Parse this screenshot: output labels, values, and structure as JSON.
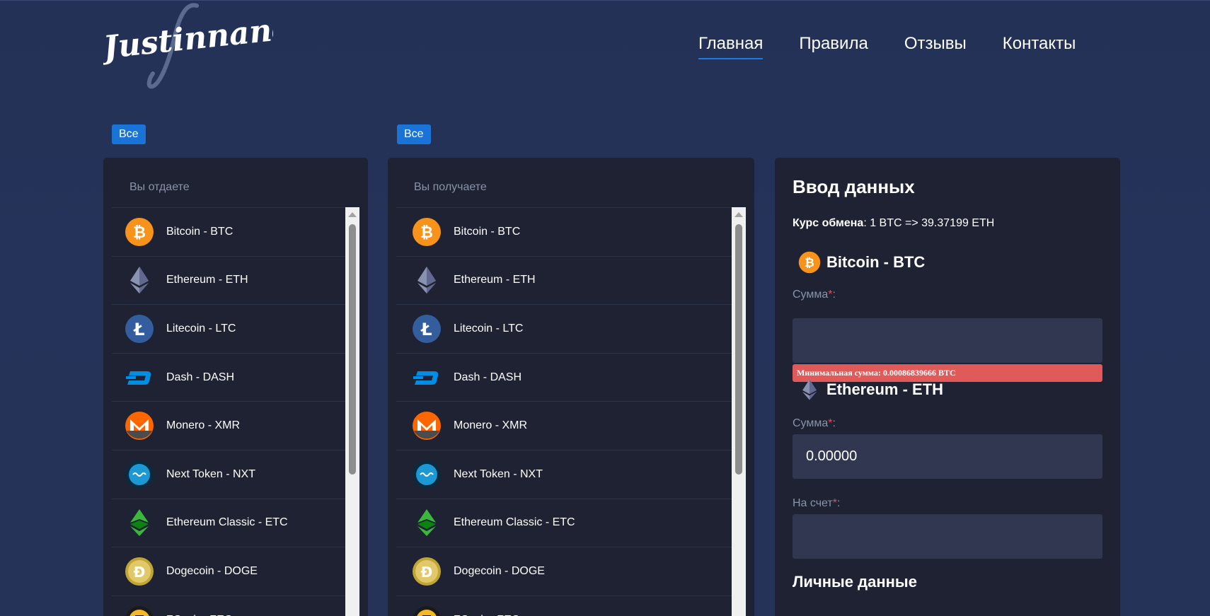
{
  "header": {
    "logo_text": "Justinnand",
    "nav": [
      {
        "label": "Главная",
        "active": true
      },
      {
        "label": "Правила",
        "active": false
      },
      {
        "label": "Отзывы",
        "active": false
      },
      {
        "label": "Контакты",
        "active": false
      }
    ]
  },
  "filters": {
    "give_label": "Все",
    "get_label": "Все"
  },
  "give_panel": {
    "title": "Вы отдаете"
  },
  "get_panel": {
    "title": "Вы получаете"
  },
  "currencies": [
    {
      "name": "Bitcoin - BTC",
      "icon": "bitcoin-icon"
    },
    {
      "name": "Ethereum - ETH",
      "icon": "ethereum-icon"
    },
    {
      "name": "Litecoin - LTC",
      "icon": "litecoin-icon"
    },
    {
      "name": "Dash - DASH",
      "icon": "dash-icon"
    },
    {
      "name": "Monero - XMR",
      "icon": "monero-icon"
    },
    {
      "name": "Next Token - NXT",
      "icon": "nxt-icon"
    },
    {
      "name": "Ethereum Classic - ETC",
      "icon": "ethereum-classic-icon"
    },
    {
      "name": "Dogecoin - DOGE",
      "icon": "dogecoin-icon"
    },
    {
      "name": "ZCash - ZEC",
      "icon": "zcash-icon"
    }
  ],
  "form": {
    "title": "Ввод данных",
    "rate_label": "Курс обмена",
    "rate_value": ": 1 BTC => 39.37199 ETH",
    "from_currency": "Bitcoin - BTC",
    "to_currency": "Ethereum - ETH",
    "amount_label": "Сумма",
    "required_mark": "*",
    "label_suffix": ":",
    "from_amount_value": "",
    "min_error": "Минимальная сумма: 0.00086839666 BTC",
    "to_amount_value": "0.00000",
    "account_label": "На счет",
    "account_value": "",
    "personal_title": "Личные данные"
  },
  "colors": {
    "background": "#233156",
    "panel": "#1e2233",
    "input": "#313651",
    "accent": "#1a73d6",
    "error": "#e05a5a"
  }
}
